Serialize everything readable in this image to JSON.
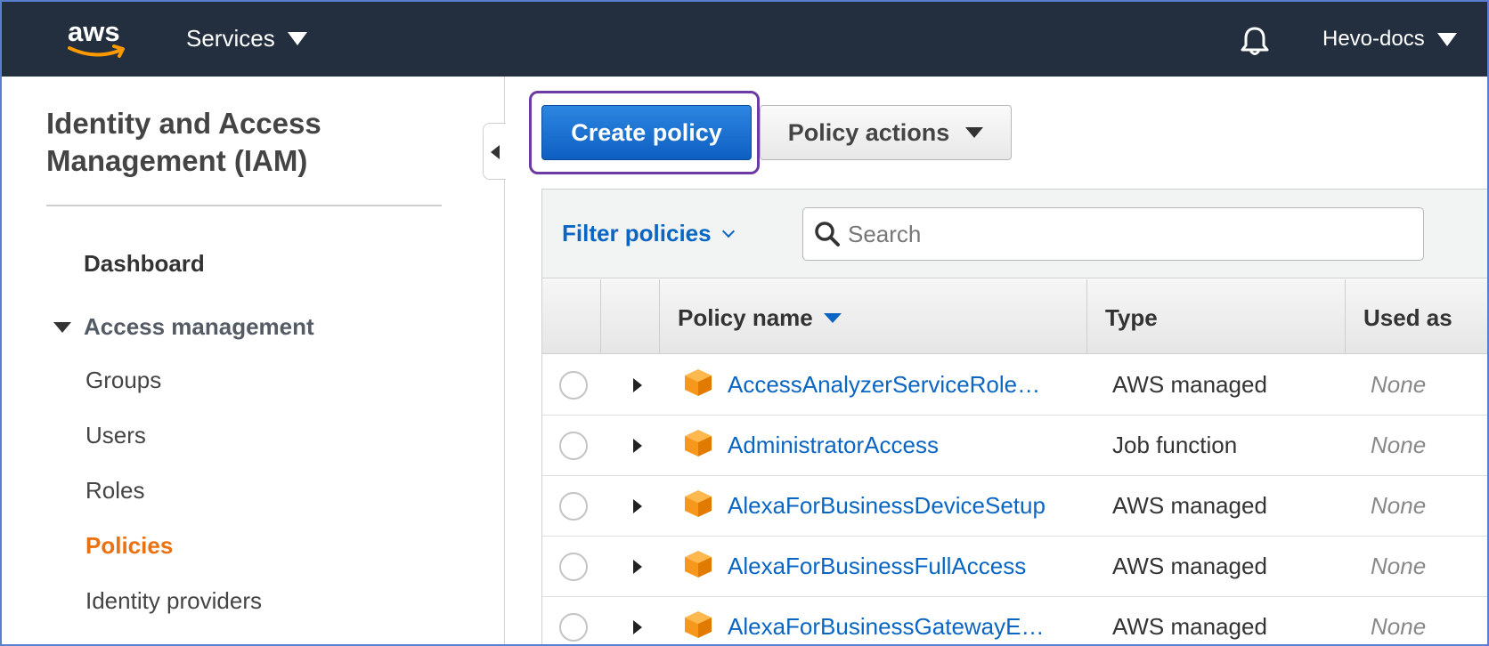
{
  "topnav": {
    "logo_text": "aws",
    "services_label": "Services",
    "account_label": "Hevo-docs",
    "bg_color": "#232f3e"
  },
  "sidebar": {
    "title": "Identity and Access Management (IAM)",
    "dashboard_label": "Dashboard",
    "section_label": "Access management",
    "items": [
      {
        "label": "Groups"
      },
      {
        "label": "Users"
      },
      {
        "label": "Roles"
      },
      {
        "label": "Policies",
        "active": true
      },
      {
        "label": "Identity providers"
      }
    ],
    "active_color": "#ec7211"
  },
  "toolbar": {
    "create_label": "Create policy",
    "actions_label": "Policy actions",
    "highlight_color": "#6c3aa4"
  },
  "filter": {
    "label": "Filter policies",
    "search_placeholder": "Search"
  },
  "table": {
    "columns": {
      "name": "Policy name",
      "type": "Type",
      "used_as": "Used as"
    },
    "rows": [
      {
        "name": "AccessAnalyzerServiceRole…",
        "type": "AWS managed",
        "used_as": "None"
      },
      {
        "name": "AdministratorAccess",
        "type": "Job function",
        "used_as": "None"
      },
      {
        "name": "AlexaForBusinessDeviceSetup",
        "type": "AWS managed",
        "used_as": "None"
      },
      {
        "name": "AlexaForBusinessFullAccess",
        "type": "AWS managed",
        "used_as": "None"
      },
      {
        "name": "AlexaForBusinessGatewayE…",
        "type": "AWS managed",
        "used_as": "None"
      }
    ],
    "icons": {
      "row_icon": "policy-cube-icon",
      "expand": "caret-right-icon",
      "sort": "sort-desc-icon"
    },
    "link_color": "#0a66c2"
  }
}
